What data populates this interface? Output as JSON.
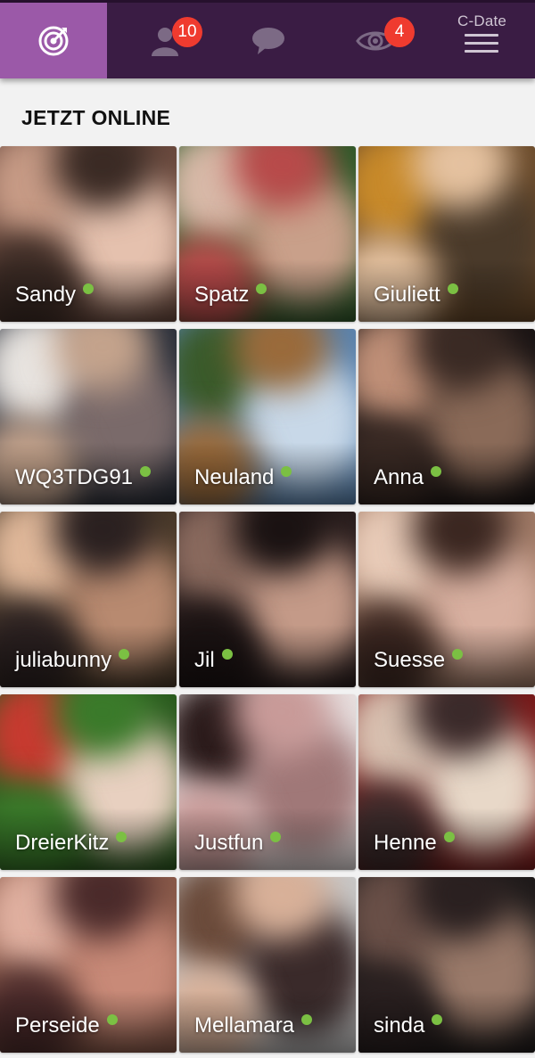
{
  "header": {
    "brand": "C-Date",
    "contacts_badge": "10",
    "visitors_badge": "4",
    "icons": [
      "target-icon",
      "person-icon",
      "chat-bubble-icon",
      "eye-icon",
      "menu-icon"
    ],
    "accent_color": "#9b59a8",
    "bar_color": "#3a1c44",
    "badge_color": "#ef3b2f"
  },
  "section": {
    "title": "JETZT ONLINE"
  },
  "online_status_color": "#7bc043",
  "profiles": [
    {
      "name": "Sandy",
      "online": true
    },
    {
      "name": "Spatz",
      "online": true
    },
    {
      "name": "Giuliett",
      "online": true
    },
    {
      "name": "WQ3TDG91",
      "online": true
    },
    {
      "name": "Neuland",
      "online": true
    },
    {
      "name": "Anna",
      "online": true
    },
    {
      "name": "juliabunny",
      "online": true
    },
    {
      "name": "Jil",
      "online": true
    },
    {
      "name": "Suesse",
      "online": true
    },
    {
      "name": "DreierKitz",
      "online": true
    },
    {
      "name": "Justfun",
      "online": true
    },
    {
      "name": "Henne",
      "online": true
    },
    {
      "name": "Perseide",
      "online": true
    },
    {
      "name": "Mellamara",
      "online": true
    },
    {
      "name": "sinda",
      "online": true
    }
  ]
}
